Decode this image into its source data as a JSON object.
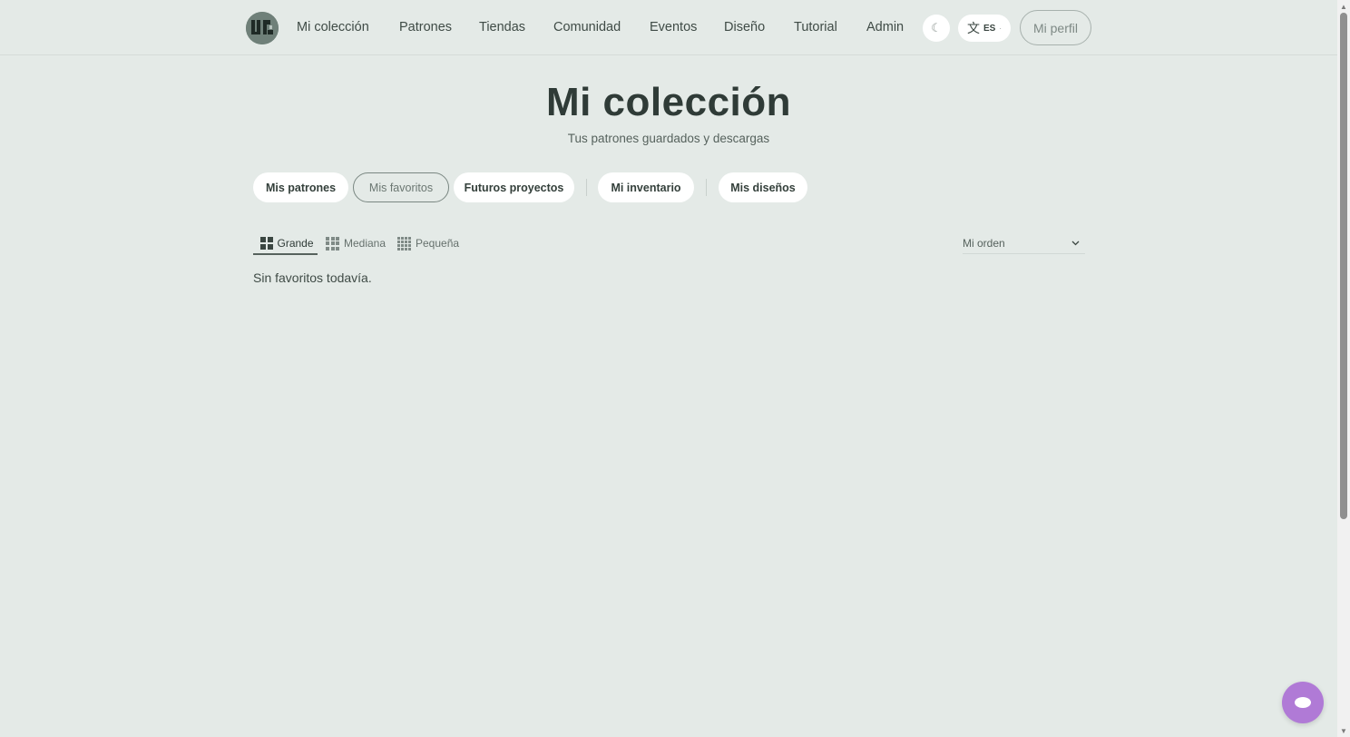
{
  "nav": {
    "items": [
      {
        "label": "Mi colección"
      },
      {
        "label": "Patrones"
      },
      {
        "label": "Tiendas"
      },
      {
        "label": "Comunidad"
      },
      {
        "label": "Eventos"
      },
      {
        "label": "Diseño"
      },
      {
        "label": "Tutorial"
      },
      {
        "label": "Admin"
      }
    ],
    "theme_icon": "☾",
    "language": {
      "glyph": "文",
      "code": "ES",
      "caret": "·"
    },
    "profile_label": "Mi perfil"
  },
  "header": {
    "title": "Mi colección",
    "subtitle": "Tus patrones guardados y descargas"
  },
  "tabs": [
    {
      "label": "Mis patrones",
      "active": false
    },
    {
      "label": "Mis favoritos",
      "active": true
    },
    {
      "label": "Futuros proyectos",
      "active": false
    },
    {
      "label": "Mi inventario",
      "active": false
    },
    {
      "label": "Mis diseños",
      "active": false
    }
  ],
  "view": {
    "options": [
      {
        "label": "Grande",
        "icon": "grid-2x2-icon",
        "active": true
      },
      {
        "label": "Mediana",
        "icon": "grid-3x3-icon",
        "active": false
      },
      {
        "label": "Pequeña",
        "icon": "grid-4x4-icon",
        "active": false
      }
    ],
    "sort": {
      "selected": "Mi orden"
    }
  },
  "content": {
    "empty_message": "Sin favoritos todavía."
  },
  "colors": {
    "background": "#e4eae7",
    "chat_button": "#b07ad6",
    "logo": "#6f8079"
  }
}
